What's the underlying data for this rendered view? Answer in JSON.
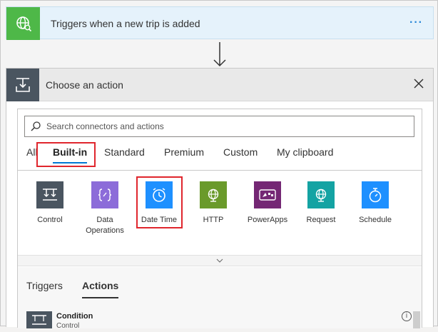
{
  "trigger": {
    "title": "Triggers when a new trip is added",
    "more": "···"
  },
  "panel": {
    "title": "Choose an action",
    "search": {
      "placeholder": "Search connectors and actions"
    },
    "tabs": [
      "All",
      "Built-in",
      "Standard",
      "Premium",
      "Custom",
      "My clipboard"
    ],
    "active_tab": "Built-in",
    "connectors": [
      {
        "label": "Control",
        "color": "#4a5560",
        "icon": "control-icon"
      },
      {
        "label": "Data Operations",
        "color": "#8c6cd9",
        "icon": "data-operations-icon"
      },
      {
        "label": "Date Time",
        "color": "#1e90ff",
        "icon": "clock-icon"
      },
      {
        "label": "HTTP",
        "color": "#6a9a2b",
        "icon": "globe-icon"
      },
      {
        "label": "PowerApps",
        "color": "#742774",
        "icon": "powerapps-icon"
      },
      {
        "label": "Request",
        "color": "#14a3a3",
        "icon": "globe-icon"
      },
      {
        "label": "Schedule",
        "color": "#1e90ff",
        "icon": "stopwatch-icon"
      }
    ],
    "subtabs": [
      "Triggers",
      "Actions"
    ],
    "active_subtab": "Actions",
    "operations": [
      {
        "name": "Condition",
        "subtitle": "Control",
        "info": "i"
      }
    ]
  },
  "colors": {
    "accent": "#0078d4",
    "highlight": "#e0262d",
    "trigger_green": "#4eb848"
  }
}
